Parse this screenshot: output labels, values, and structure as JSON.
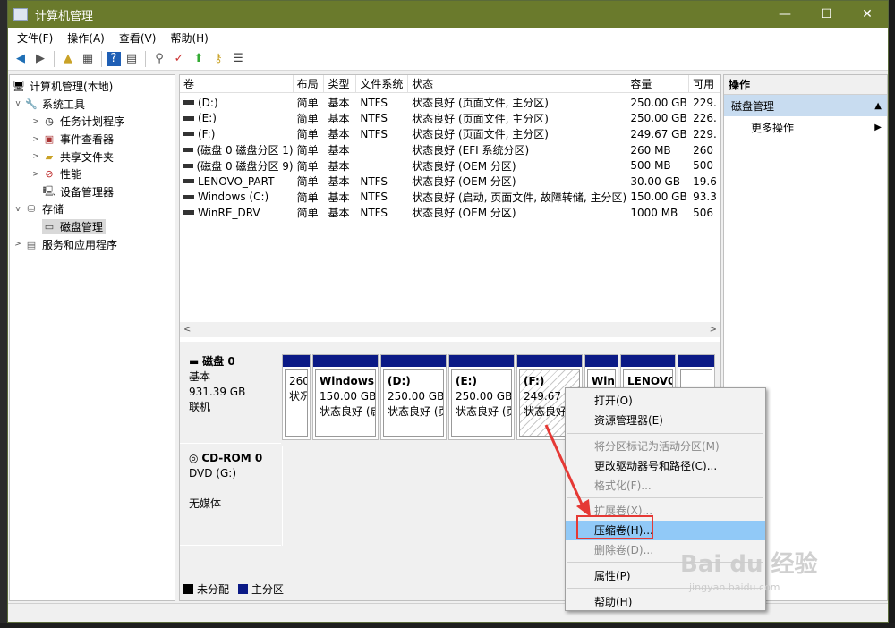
{
  "title": "计算机管理",
  "window_controls": {
    "min": "—",
    "max": "☐",
    "close": "✕"
  },
  "menu": [
    "文件(F)",
    "操作(A)",
    "查看(V)",
    "帮助(H)"
  ],
  "tree": [
    {
      "label": "计算机管理(本地)",
      "level": 0,
      "arrow": "",
      "icon": "computer-icon"
    },
    {
      "label": "系统工具",
      "level": 1,
      "arrow": "v",
      "icon": "tools-icon"
    },
    {
      "label": "任务计划程序",
      "level": 2,
      "arrow": ">",
      "icon": "clock-icon"
    },
    {
      "label": "事件查看器",
      "level": 2,
      "arrow": ">",
      "icon": "event-viewer-icon"
    },
    {
      "label": "共享文件夹",
      "level": 2,
      "arrow": ">",
      "icon": "shared-folder-icon"
    },
    {
      "label": "性能",
      "level": 2,
      "arrow": ">",
      "icon": "performance-icon"
    },
    {
      "label": "设备管理器",
      "level": 2,
      "arrow": "",
      "icon": "device-manager-icon"
    },
    {
      "label": "存储",
      "level": 1,
      "arrow": "v",
      "icon": "storage-icon"
    },
    {
      "label": "磁盘管理",
      "level": 2,
      "arrow": "",
      "icon": "disk-management-icon",
      "selected": true
    },
    {
      "label": "服务和应用程序",
      "level": 1,
      "arrow": ">",
      "icon": "services-icon"
    }
  ],
  "table": {
    "headers": [
      "卷",
      "布局",
      "类型",
      "文件系统",
      "状态",
      "容量",
      "可用"
    ],
    "rows": [
      [
        "(D:)",
        "简单",
        "基本",
        "NTFS",
        "状态良好 (页面文件, 主分区)",
        "250.00 GB",
        "229."
      ],
      [
        "(E:)",
        "简单",
        "基本",
        "NTFS",
        "状态良好 (页面文件, 主分区)",
        "250.00 GB",
        "226."
      ],
      [
        "(F:)",
        "简单",
        "基本",
        "NTFS",
        "状态良好 (页面文件, 主分区)",
        "249.67 GB",
        "229."
      ],
      [
        "(磁盘 0 磁盘分区 1)",
        "简单",
        "基本",
        "",
        "状态良好 (EFI 系统分区)",
        "260 MB",
        "260"
      ],
      [
        "(磁盘 0 磁盘分区 9)",
        "简单",
        "基本",
        "",
        "状态良好 (OEM 分区)",
        "500 MB",
        "500"
      ],
      [
        "LENOVO_PART",
        "简单",
        "基本",
        "NTFS",
        "状态良好 (OEM 分区)",
        "30.00 GB",
        "19.6"
      ],
      [
        "Windows (C:)",
        "简单",
        "基本",
        "NTFS",
        "状态良好 (启动, 页面文件, 故障转储, 主分区)",
        "150.00 GB",
        "93.3"
      ],
      [
        "WinRE_DRV",
        "简单",
        "基本",
        "NTFS",
        "状态良好 (OEM 分区)",
        "1000 MB",
        "506"
      ]
    ]
  },
  "disk0": {
    "name": "磁盘 0",
    "type": "基本",
    "size": "931.39 GB",
    "status": "联机"
  },
  "partitions": [
    {
      "name": "",
      "l1": "260",
      "l2": "状况"
    },
    {
      "name": "Windows",
      "l1": "150.00 GB",
      "l2": "状态良好 (启"
    },
    {
      "name": "(D:)",
      "l1": "250.00 GB",
      "l2": "状态良好 (页"
    },
    {
      "name": "(E:)",
      "l1": "250.00 GB",
      "l2": "状态良好 (页"
    },
    {
      "name": "(F:)",
      "l1": "249.67 G",
      "l2": "状态良好"
    },
    {
      "name": "Win",
      "l1": "",
      "l2": ""
    },
    {
      "name": "LENOVO",
      "l1": "",
      "l2": ""
    },
    {
      "name": "",
      "l1": "",
      "l2": ""
    }
  ],
  "cdrom": {
    "name": "CD-ROM 0",
    "drive": "DVD (G:)",
    "media": "无媒体"
  },
  "legend": {
    "unallocated": "未分配",
    "primary": "主分区"
  },
  "actions": {
    "header": "操作",
    "group": "磁盘管理",
    "more": "更多操作"
  },
  "context_menu": {
    "open": "打开(O)",
    "explorer": "资源管理器(E)",
    "mark_active": "将分区标记为活动分区(M)",
    "change_letter": "更改驱动器号和路径(C)...",
    "format": "格式化(F)...",
    "extend": "扩展卷(X)...",
    "shrink": "压缩卷(H)...",
    "delete": "删除卷(D)...",
    "properties": "属性(P)",
    "help": "帮助(H)"
  },
  "watermark": {
    "brand": "Bai du 经验",
    "url": "jingyan.baidu.com"
  },
  "colors": {
    "titlebar": "#6a7a2c",
    "primary_partition": "#0b1a86",
    "highlight": "#91c9f7",
    "annotation": "#e53935"
  }
}
